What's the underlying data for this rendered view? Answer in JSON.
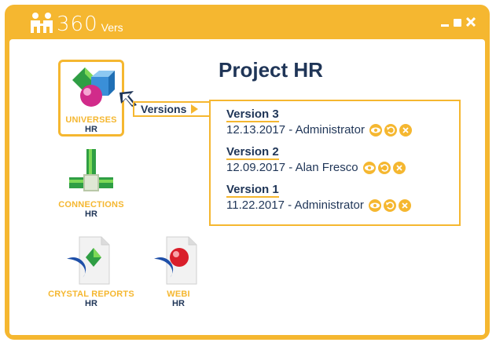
{
  "window": {
    "logo_text": "360",
    "logo_sub": "Vers"
  },
  "sidebar": {
    "items": [
      {
        "label": "UNIVERSES",
        "sub": "HR",
        "selected": true
      },
      {
        "label": "CONNECTIONS",
        "sub": "HR"
      },
      {
        "label": "CRYSTAL REPORTS",
        "sub": "HR"
      },
      {
        "label": "WEBI",
        "sub": "HR"
      }
    ]
  },
  "main": {
    "title": "Project HR",
    "versions_label": "Versions",
    "versions": [
      {
        "name": "Version 3",
        "detail": "12.13.2017 - Administrator"
      },
      {
        "name": "Version 2",
        "detail": "12.09.2017 - Alan Fresco"
      },
      {
        "name": "Version 1",
        "detail": "11.22.2017 - Administrator"
      }
    ]
  },
  "colors": {
    "accent": "#f5b730",
    "navy": "#1f3557"
  },
  "icons": [
    "minimize-icon",
    "maximize-icon",
    "close-icon",
    "view-icon",
    "restore-icon",
    "delete-icon"
  ]
}
